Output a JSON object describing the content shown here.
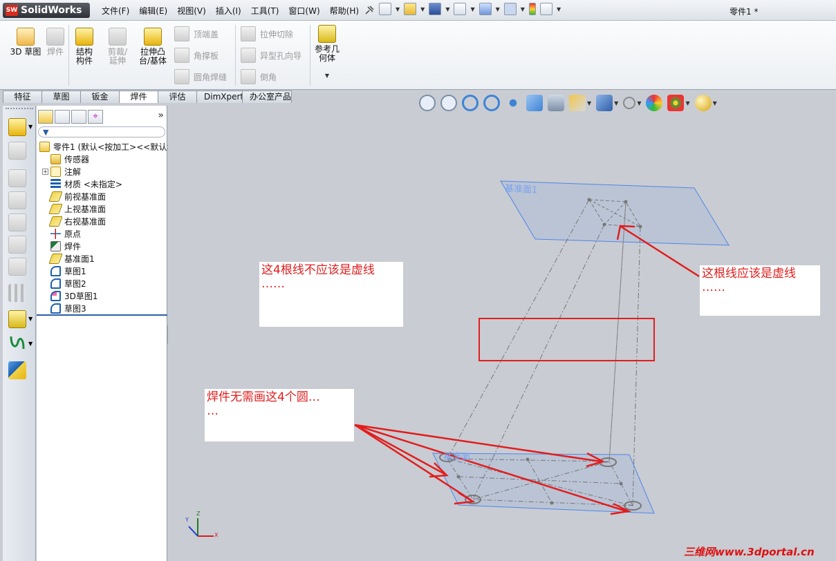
{
  "app": {
    "logo_text": "SolidWorks",
    "logo_mark": "SW",
    "document_title": "零件1 *"
  },
  "menu": [
    "文件(F)",
    "编辑(E)",
    "视图(V)",
    "插入(I)",
    "工具(T)",
    "窗口(W)",
    "帮助(H)"
  ],
  "quick_icons": [
    "new-icon",
    "open-icon",
    "save-icon",
    "print-icon",
    "undo-icon",
    "select-icon",
    "rebuild-icon",
    "options-icon"
  ],
  "ribbon": {
    "sketch3d": "3D 草图",
    "weldment": "焊件",
    "structural_member": "结构构件",
    "trim_extend": "剪裁/延伸",
    "extruded_boss": "拉伸凸台/基体",
    "end_cap": "顶端盖",
    "gusset": "角撑板",
    "fillet_bead": "圆角焊缝",
    "extruded_cut": "拉伸切除",
    "hole_wizard": "异型孔向导",
    "chamfer": "倒角",
    "reference_geometry": "参考几何体"
  },
  "tabs": [
    "特征",
    "草图",
    "钣金",
    "焊件",
    "评估",
    "DimXpert",
    "办公室产品"
  ],
  "active_tab": "焊件",
  "feature_tree": [
    {
      "label": "零件1 (默认<按加工><<默认>",
      "icon": "part-icon",
      "indent": 0,
      "expander": ""
    },
    {
      "label": "传感器",
      "icon": "sensor-icon",
      "indent": 1,
      "expander": ""
    },
    {
      "label": "注解",
      "icon": "annotation-icon",
      "indent": 1,
      "expander": "+"
    },
    {
      "label": "材质 <未指定>",
      "icon": "material-icon",
      "indent": 1,
      "expander": ""
    },
    {
      "label": "前视基准面",
      "icon": "plane-icon",
      "indent": 1,
      "expander": ""
    },
    {
      "label": "上视基准面",
      "icon": "plane-icon",
      "indent": 1,
      "expander": ""
    },
    {
      "label": "右视基准面",
      "icon": "plane-icon",
      "indent": 1,
      "expander": ""
    },
    {
      "label": "原点",
      "icon": "origin-icon",
      "indent": 1,
      "expander": ""
    },
    {
      "label": "焊件",
      "icon": "weldment-icon",
      "indent": 1,
      "expander": ""
    },
    {
      "label": "基准面1",
      "icon": "plane-icon",
      "indent": 1,
      "expander": ""
    },
    {
      "label": "草图1",
      "icon": "sketch-icon",
      "indent": 1,
      "expander": ""
    },
    {
      "label": "草图2",
      "icon": "sketch-icon",
      "indent": 1,
      "expander": ""
    },
    {
      "label": "3D草图1",
      "icon": "sketch3d-icon",
      "indent": 1,
      "expander": ""
    },
    {
      "label": "草图3",
      "icon": "sketch-icon",
      "indent": 1,
      "expander": ""
    }
  ],
  "viewport": {
    "top_plane_label": "基准面1",
    "bottom_plane_label": "基准面",
    "triad_y": "Y",
    "triad_z": "Z",
    "triad_x": "X"
  },
  "notes": {
    "dashed_four": "这4根线不应该是虚线\n……",
    "should_be_dashed": "这根线应该是虚线\n……",
    "no_circles": "焊件无需画这4个圆…\n…"
  },
  "watermark": "三维网www.3dportal.cn",
  "colors": {
    "annotation_red": "#e21d1d",
    "plane_blue": "#4f86e8",
    "viewport_bg": "#c9ccd2"
  }
}
